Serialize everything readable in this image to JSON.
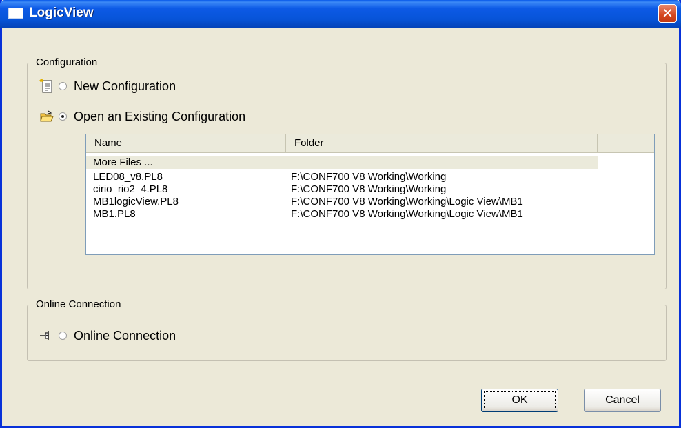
{
  "window": {
    "title": "LogicView",
    "close_icon": "close-icon"
  },
  "configuration": {
    "legend": "Configuration",
    "new_label": "New Configuration",
    "open_label": "Open an Existing Configuration",
    "selected": "open"
  },
  "file_list": {
    "columns": [
      "Name",
      "Folder"
    ],
    "more_label": "More Files ...",
    "rows": [
      {
        "name": "LED08_v8.PL8",
        "folder": "F:\\CONF700 V8 Working\\Working"
      },
      {
        "name": "cirio_rio2_4.PL8",
        "folder": "F:\\CONF700 V8 Working\\Working"
      },
      {
        "name": "MB1logicView.PL8",
        "folder": "F:\\CONF700 V8 Working\\Working\\Logic View\\MB1"
      },
      {
        "name": "MB1.PL8",
        "folder": "F:\\CONF700 V8 Working\\Working\\Logic View\\MB1"
      }
    ]
  },
  "online": {
    "legend": "Online Connection",
    "label": "Online Connection"
  },
  "buttons": {
    "ok": "OK",
    "cancel": "Cancel"
  },
  "colors": {
    "titlebar": "#0754d8",
    "dialog_bg": "#ece9d8",
    "close": "#d5471f"
  }
}
